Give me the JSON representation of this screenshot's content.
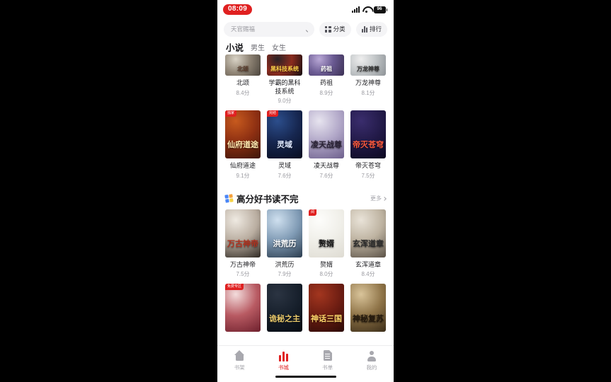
{
  "status_bar": {
    "time": "08:09",
    "battery_level": "96",
    "signal_icon": "signal-bars-icon",
    "wifi_icon": "wifi-icon",
    "battery_icon": "battery-icon"
  },
  "search": {
    "placeholder": "天官赐福",
    "search_icon": "search-icon",
    "category_label": "分类",
    "category_icon": "grid-icon",
    "ranking_label": "排行",
    "ranking_icon": "bar-chart-icon"
  },
  "tabs": [
    {
      "label": "小说",
      "active": true
    },
    {
      "label": "男生",
      "active": false
    },
    {
      "label": "女生",
      "active": false
    }
  ],
  "top_books": {
    "row1": [
      {
        "title": "北颂",
        "score": "8.4分",
        "cover_text": "北颂",
        "c1": "#d9d3c6",
        "c2": "#8e8374",
        "c3": "#4a443c",
        "text_color": "#5a3b2a",
        "badge": ""
      },
      {
        "title": "学霸的黑科技系统",
        "score": "9.0分",
        "cover_text": "黑科技系统",
        "c1": "#2a2226",
        "c2": "#8a2b1e",
        "c3": "#120d10",
        "text_color": "#ffd24a",
        "badge": ""
      },
      {
        "title": "药祖",
        "score": "8.9分",
        "cover_text": "药祖",
        "c1": "#b9a8d6",
        "c2": "#6a5a92",
        "c3": "#3a2f52",
        "text_color": "#ffffff",
        "badge": ""
      },
      {
        "title": "万龙神尊",
        "score": "8.1分",
        "cover_text": "万龙神尊",
        "c1": "#eeeeee",
        "c2": "#c2c6c8",
        "c3": "#8d9296",
        "text_color": "#333333",
        "badge": ""
      }
    ],
    "row2": [
      {
        "title": "仙府道途",
        "score": "9.1分",
        "cover_text": "仙府道途",
        "c1": "#c75a1e",
        "c2": "#8d2f12",
        "c3": "#3d1608",
        "text_color": "#ffe9b0",
        "badge": "独家"
      },
      {
        "title": "灵域",
        "score": "7.6分",
        "cover_text": "灵域",
        "c1": "#2c4e8c",
        "c2": "#16264f",
        "c3": "#070d20",
        "text_color": "#dfe9ff",
        "badge": "完结"
      },
      {
        "title": "凌天战尊",
        "score": "7.6分",
        "cover_text": "凌天战尊",
        "c1": "#e7e4ef",
        "c2": "#b0a6c7",
        "c3": "#6d5f8c",
        "text_color": "#2a2236",
        "badge": ""
      },
      {
        "title": "帝灭苍穹",
        "score": "7.5分",
        "cover_text": "帝灭苍穹",
        "c1": "#3a2d6d",
        "c2": "#221a48",
        "c3": "#0c0821",
        "text_color": "#ff5a3c",
        "badge": ""
      }
    ]
  },
  "section": {
    "icon": "colored-squares-icon",
    "title": "高分好书读不完",
    "more_label": "更多",
    "more_icon": "chevron-right-icon",
    "row1": [
      {
        "title": "万古神帝",
        "score": "7.5分",
        "cover_text": "万古神帝",
        "c1": "#efeae2",
        "c2": "#b9ada0",
        "c3": "#2e2822",
        "text_color": "#b0301d",
        "badge": ""
      },
      {
        "title": "洪荒历",
        "score": "7.9分",
        "cover_text": "洪荒历",
        "c1": "#cfe0ef",
        "c2": "#7f9ab4",
        "c3": "#2b3c4e",
        "text_color": "#ffffff",
        "badge": ""
      },
      {
        "title": "赘婿",
        "score": "8.0分",
        "cover_text": "赘婿",
        "c1": "#fdfdfb",
        "c2": "#f0efe9",
        "c3": "#dedbd2",
        "text_color": "#1b1b1b",
        "badge": "阅"
      },
      {
        "title": "玄浑道章",
        "score": "8.4分",
        "cover_text": "玄浑道章",
        "c1": "#e9e3d8",
        "c2": "#bdb2a0",
        "c3": "#5a5146",
        "text_color": "#2b2b2b",
        "badge": ""
      }
    ],
    "row2": [
      {
        "title": "",
        "score": "",
        "cover_text": "",
        "c1": "#f3dcdc",
        "c2": "#b85a62",
        "c3": "#6d1f2c",
        "text_color": "#ffffff",
        "badge": "免费专区"
      },
      {
        "title": "",
        "score": "",
        "cover_text": "诡秘之主",
        "c1": "#2b3442",
        "c2": "#17202c",
        "c3": "#070b12",
        "text_color": "#e8c86a",
        "badge": ""
      },
      {
        "title": "",
        "score": "",
        "cover_text": "神话三国",
        "c1": "#a3361f",
        "c2": "#6d1d12",
        "c3": "#2a0a06",
        "text_color": "#ffd66a",
        "badge": ""
      },
      {
        "title": "",
        "score": "",
        "cover_text": "神秘复苏",
        "c1": "#d9c49a",
        "c2": "#8e7347",
        "c3": "#3a2c18",
        "text_color": "#23180c",
        "badge": ""
      }
    ]
  },
  "bottom_nav": [
    {
      "label": "书架",
      "icon": "home-icon",
      "active": false
    },
    {
      "label": "书城",
      "icon": "bar-chart-icon",
      "active": true
    },
    {
      "label": "书单",
      "icon": "document-icon",
      "active": false
    },
    {
      "label": "我的",
      "icon": "person-icon",
      "active": false
    }
  ],
  "home_indicator": "home-indicator"
}
